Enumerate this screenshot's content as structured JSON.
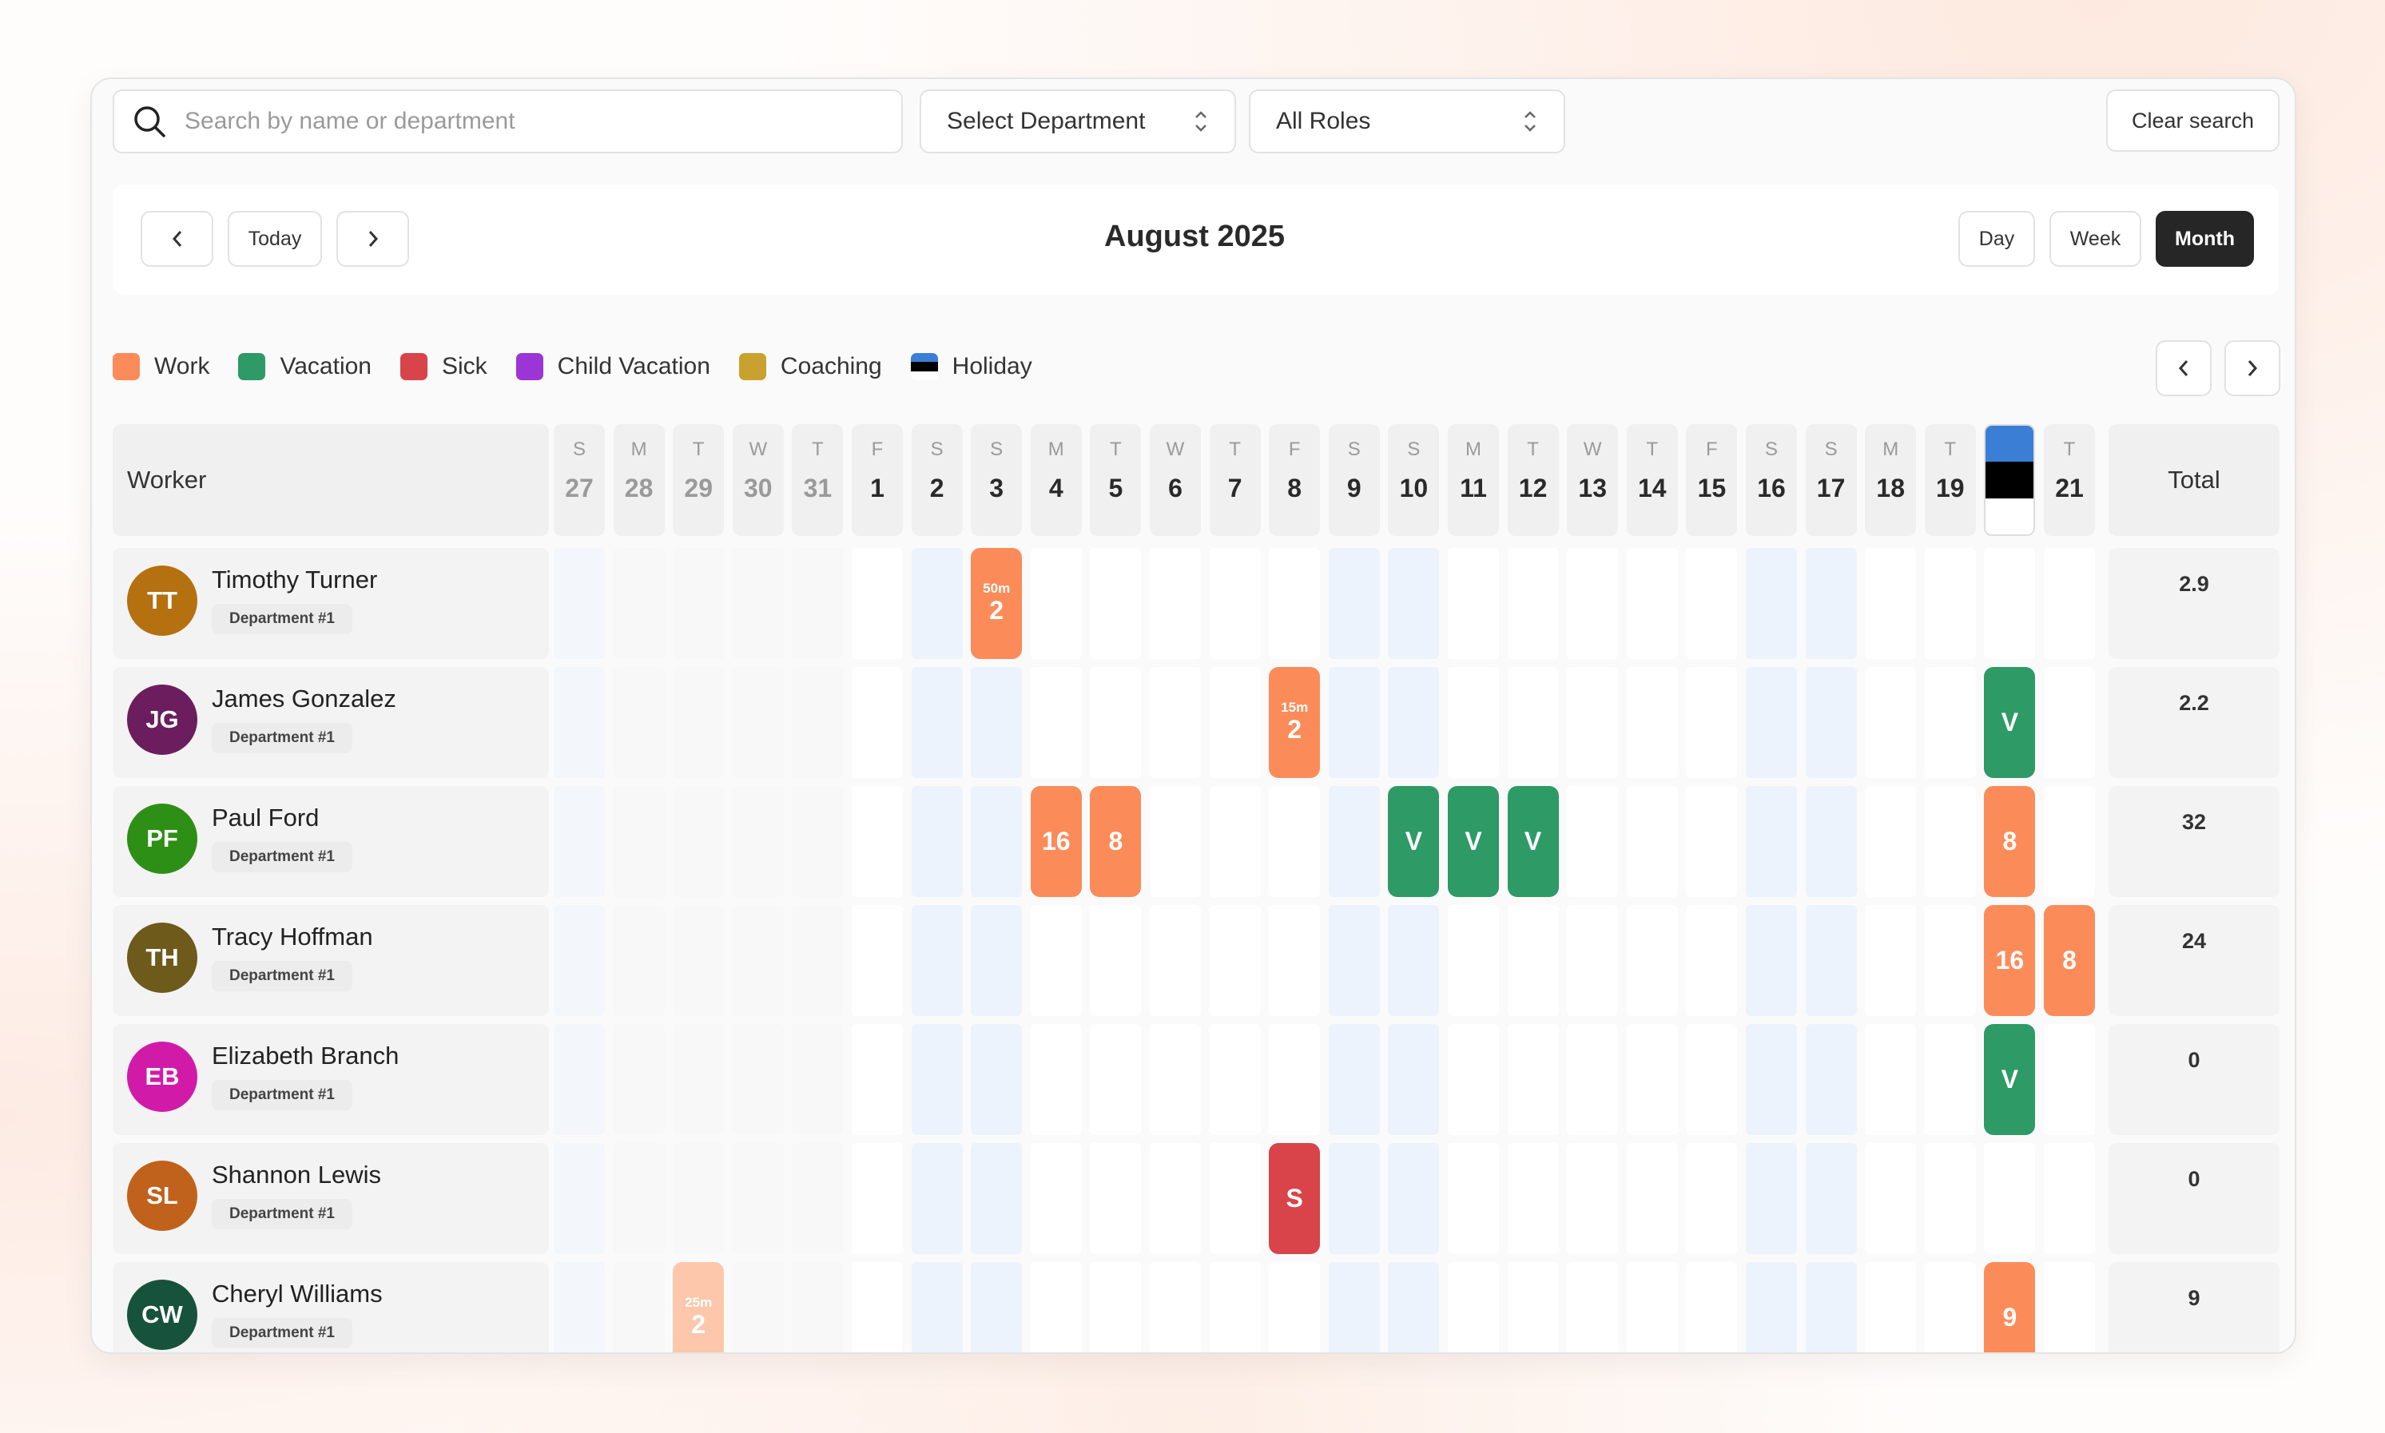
{
  "search": {
    "placeholder": "Search by name or department",
    "value": ""
  },
  "department_select": {
    "label": "Select Department"
  },
  "role_select": {
    "label": "All Roles"
  },
  "clear_search": {
    "label": "Clear search"
  },
  "nav": {
    "today": "Today",
    "month_title": "August 2025",
    "views": [
      "Day",
      "Week",
      "Month"
    ],
    "active_view": "Month"
  },
  "legend": [
    {
      "label": "Work",
      "color": "#fb8c5a"
    },
    {
      "label": "Vacation",
      "color": "#2e9a66"
    },
    {
      "label": "Sick",
      "color": "#d9434a"
    },
    {
      "label": "Child Vacation",
      "color": "#9b35d6"
    },
    {
      "label": "Coaching",
      "color": "#c9a12e"
    },
    {
      "label": "Holiday",
      "color": "flag"
    }
  ],
  "table": {
    "worker_header": "Worker",
    "total_header": "Total",
    "days": [
      {
        "l": "S",
        "n": "27",
        "cur": false,
        "weekend": true
      },
      {
        "l": "M",
        "n": "28",
        "cur": false,
        "weekend": false
      },
      {
        "l": "T",
        "n": "29",
        "cur": false,
        "weekend": false
      },
      {
        "l": "W",
        "n": "30",
        "cur": false,
        "weekend": false
      },
      {
        "l": "T",
        "n": "31",
        "cur": false,
        "weekend": false
      },
      {
        "l": "F",
        "n": "1",
        "cur": true,
        "weekend": false
      },
      {
        "l": "S",
        "n": "2",
        "cur": true,
        "weekend": true
      },
      {
        "l": "S",
        "n": "3",
        "cur": true,
        "weekend": true
      },
      {
        "l": "M",
        "n": "4",
        "cur": true,
        "weekend": false
      },
      {
        "l": "T",
        "n": "5",
        "cur": true,
        "weekend": false
      },
      {
        "l": "W",
        "n": "6",
        "cur": true,
        "weekend": false
      },
      {
        "l": "T",
        "n": "7",
        "cur": true,
        "weekend": false
      },
      {
        "l": "F",
        "n": "8",
        "cur": true,
        "weekend": false
      },
      {
        "l": "S",
        "n": "9",
        "cur": true,
        "weekend": true
      },
      {
        "l": "S",
        "n": "10",
        "cur": true,
        "weekend": true
      },
      {
        "l": "M",
        "n": "11",
        "cur": true,
        "weekend": false
      },
      {
        "l": "T",
        "n": "12",
        "cur": true,
        "weekend": false
      },
      {
        "l": "W",
        "n": "13",
        "cur": true,
        "weekend": false
      },
      {
        "l": "T",
        "n": "14",
        "cur": true,
        "weekend": false
      },
      {
        "l": "F",
        "n": "15",
        "cur": true,
        "weekend": false
      },
      {
        "l": "S",
        "n": "16",
        "cur": true,
        "weekend": true
      },
      {
        "l": "S",
        "n": "17",
        "cur": true,
        "weekend": true
      },
      {
        "l": "M",
        "n": "18",
        "cur": true,
        "weekend": false
      },
      {
        "l": "T",
        "n": "19",
        "cur": true,
        "weekend": false
      },
      {
        "l": "",
        "n": "",
        "cur": true,
        "weekend": false,
        "holiday": true
      },
      {
        "l": "T",
        "n": "21",
        "cur": true,
        "weekend": false
      }
    ],
    "workers": [
      {
        "initials": "TT",
        "name": "Timothy Turner",
        "dept": "Department #1",
        "color": "#b5700f",
        "total": "2.9",
        "events": [
          {
            "day": 7,
            "type": "work",
            "top": "50m",
            "main": "2"
          }
        ]
      },
      {
        "initials": "JG",
        "name": "James Gonzalez",
        "dept": "Department #1",
        "color": "#6b1d5e",
        "total": "2.2",
        "events": [
          {
            "day": 12,
            "type": "work",
            "top": "15m",
            "main": "2"
          },
          {
            "day": 24,
            "type": "vacation",
            "top": "",
            "main": "V"
          }
        ]
      },
      {
        "initials": "PF",
        "name": "Paul Ford",
        "dept": "Department #1",
        "color": "#2e8f16",
        "total": "32",
        "events": [
          {
            "day": 8,
            "type": "work",
            "top": "",
            "main": "16"
          },
          {
            "day": 9,
            "type": "work",
            "top": "",
            "main": "8"
          },
          {
            "day": 14,
            "type": "vacation",
            "top": "",
            "main": "V"
          },
          {
            "day": 15,
            "type": "vacation",
            "top": "",
            "main": "V"
          },
          {
            "day": 16,
            "type": "vacation",
            "top": "",
            "main": "V"
          },
          {
            "day": 24,
            "type": "work",
            "top": "",
            "main": "8"
          }
        ]
      },
      {
        "initials": "TH",
        "name": "Tracy Hoffman",
        "dept": "Department #1",
        "color": "#6e5a1b",
        "total": "24",
        "events": [
          {
            "day": 24,
            "type": "work",
            "top": "",
            "main": "16"
          },
          {
            "day": 25,
            "type": "work",
            "top": "",
            "main": "8"
          }
        ]
      },
      {
        "initials": "EB",
        "name": "Elizabeth Branch",
        "dept": "Department #1",
        "color": "#d21aa9",
        "total": "0",
        "events": [
          {
            "day": 24,
            "type": "vacation",
            "top": "",
            "main": "V"
          }
        ]
      },
      {
        "initials": "SL",
        "name": "Shannon Lewis",
        "dept": "Department #1",
        "color": "#c0621b",
        "total": "0",
        "events": [
          {
            "day": 12,
            "type": "sick",
            "top": "",
            "main": "S"
          }
        ]
      },
      {
        "initials": "CW",
        "name": "Cheryl Williams",
        "dept": "Department #1",
        "color": "#17523d",
        "total": "9",
        "events": [
          {
            "day": 2,
            "type": "work-faded",
            "top": "25m",
            "main": "2"
          },
          {
            "day": 24,
            "type": "work",
            "top": "",
            "main": "9"
          }
        ]
      }
    ]
  },
  "colors": {
    "work": "#fb8c5a",
    "work_faded": "#fcc7ab",
    "vacation": "#2e9a66",
    "sick": "#d9434a",
    "weekend_bg": "#edf3fc",
    "weekday_bg": "#ffffff",
    "prev_bg": "#f8f8f8",
    "prev_weekend_bg": "#f3f6fb"
  }
}
